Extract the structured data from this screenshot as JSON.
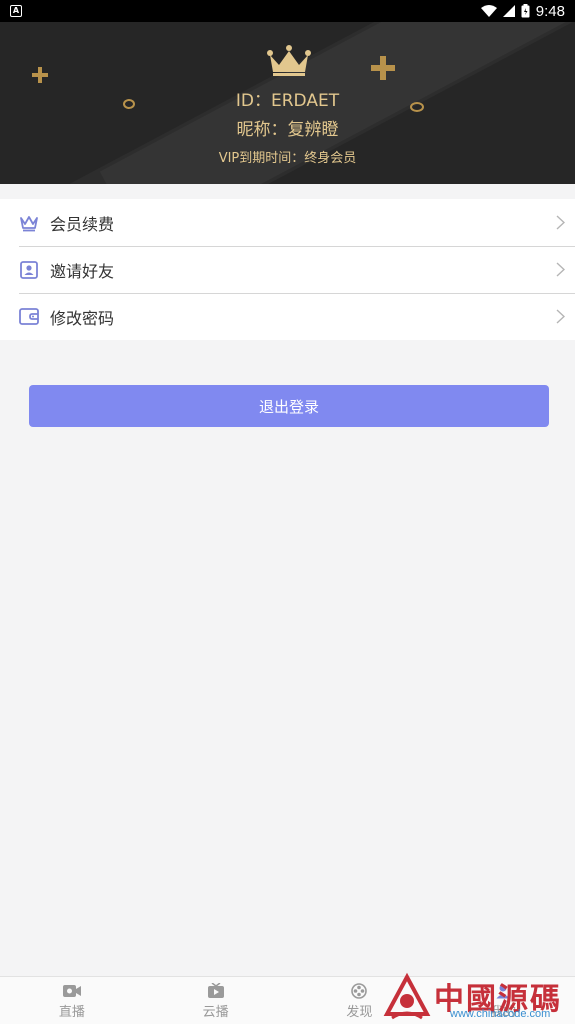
{
  "status_bar": {
    "app_badge": "A",
    "time": "9:48"
  },
  "header": {
    "user_id": "ID：ERDAET",
    "nickname": "昵称：复辨瞪",
    "vip_expire": "VIP到期时间：终身会员",
    "accent_color": "#e2c78e"
  },
  "menu": {
    "items": [
      {
        "label": "会员续费",
        "icon": "crown-icon"
      },
      {
        "label": "邀请好友",
        "icon": "person-card-icon"
      },
      {
        "label": "修改密码",
        "icon": "wallet-icon"
      }
    ]
  },
  "logout": {
    "label": "退出登录",
    "color": "#8089f0"
  },
  "bottom_nav": {
    "items": [
      {
        "label": "直播",
        "icon": "camera-icon"
      },
      {
        "label": "云播",
        "icon": "play-box-icon"
      },
      {
        "label": "发现",
        "icon": "compass-icon"
      },
      {
        "label": "我的",
        "icon": "user-icon"
      }
    ]
  },
  "watermark": {
    "title": "中國源碼",
    "url": "www.chinacode.com"
  }
}
